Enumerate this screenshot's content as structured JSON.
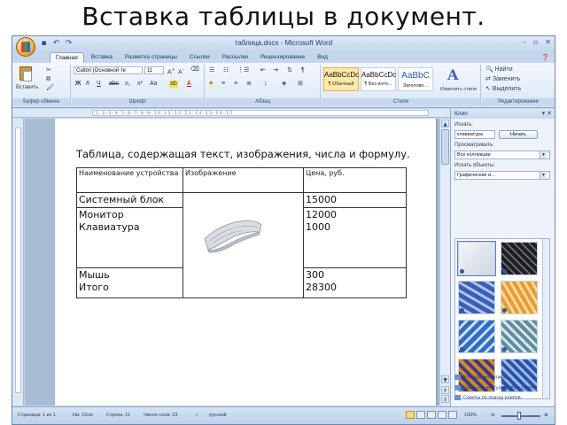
{
  "slide_title": "Вставка таблицы в документ.",
  "window": {
    "title": "таблица.docx - Microsoft Word",
    "controls": [
      "–",
      "▫",
      "✕"
    ],
    "qat_icons": [
      "save-icon",
      "undo-icon",
      "redo-icon"
    ]
  },
  "tabs": [
    "Главная",
    "Вставка",
    "Разметка страницы",
    "Ссылки",
    "Рассылки",
    "Рецензирование",
    "Вид"
  ],
  "ribbon": {
    "clipboard": {
      "label": "Буфер обмена",
      "paste": "Вставить"
    },
    "font": {
      "label": "Шрифт",
      "font_name": "Calibri (Основной те",
      "font_size": "11"
    },
    "paragraph": {
      "label": "Абзац"
    },
    "styles": {
      "label": "Стили",
      "items": [
        {
          "sample": "AaBbCcDc",
          "name": "¶ Обычный"
        },
        {
          "sample": "AaBbCcDc",
          "name": "¶ Без инте..."
        },
        {
          "sample": "AaBbC",
          "name": "Заголово..."
        }
      ],
      "change": "Изменить стили"
    },
    "editing": {
      "label": "Редактирование",
      "find": "Найти",
      "replace": "Заменить",
      "select": "Выделить"
    }
  },
  "document": {
    "heading": "Таблица, содержащая текст, изображения, числа и формулу.",
    "table": {
      "headers": [
        "Наименование устройства",
        "Изображение",
        "Цена, руб."
      ],
      "rows": [
        {
          "name": "Системный блок",
          "price": "15000"
        },
        {
          "name": "Монитор\nКлавиатура",
          "price": "12000\n1000"
        },
        {
          "name": "Мышь\nИтого",
          "price": "300\n28300"
        }
      ]
    }
  },
  "clipart_pane": {
    "title": "Клип",
    "search_label": "Искать:",
    "search_value": "клавиатура",
    "search_button": "Начать",
    "scope_label": "Просматривать:",
    "scope_value": "Все коллекции",
    "types_label": "Искать объекты:",
    "types_value": "Графические и...",
    "links": [
      "Упорядочить клипы...",
      "Клипы на веб-узле Office Online",
      "Советы по поиску клипов"
    ]
  },
  "status": {
    "page": "Страница: 1 из 1",
    "position": "На: 12см",
    "line": "Строка: 11",
    "words": "Число слов: 23",
    "language": "русский",
    "zoom": "100%"
  }
}
